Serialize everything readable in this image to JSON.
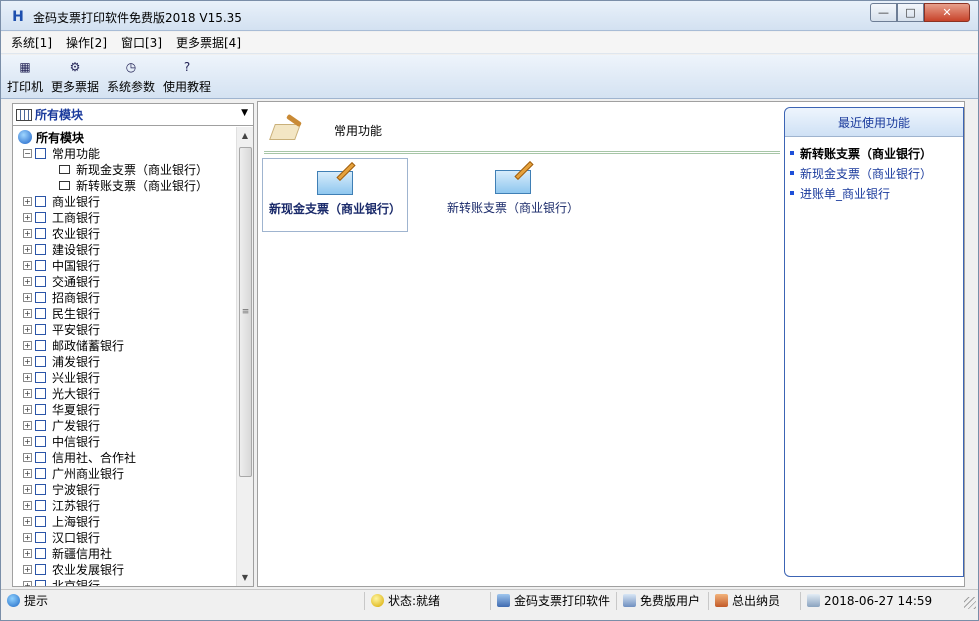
{
  "window": {
    "title": "金码支票打印软件免费版2018  V15.35",
    "min_label": "—",
    "max_label": "□",
    "close_label": "✕"
  },
  "menu": [
    "系统[1]",
    "操作[2]",
    "窗口[3]",
    "更多票据[4]"
  ],
  "toolbar": {
    "items": [
      {
        "label": "打印机",
        "icon": "printer-icon",
        "glyph": "▦"
      },
      {
        "label": "更多票据",
        "icon": "tickets-icon",
        "glyph": "⚙"
      },
      {
        "label": "系统参数",
        "icon": "settings-icon",
        "glyph": "◷"
      },
      {
        "label": "使用教程",
        "icon": "help-icon",
        "glyph": "?"
      }
    ]
  },
  "sidebar": {
    "header": "所有模块",
    "root": "所有模块",
    "common": {
      "label": "常用功能",
      "children": [
        "新现金支票（商业银行）",
        "新转账支票（商业银行）"
      ]
    },
    "banks": [
      "商业银行",
      "工商银行",
      "农业银行",
      "建设银行",
      "中国银行",
      "交通银行",
      "招商银行",
      "民生银行",
      "平安银行",
      "邮政储蓄银行",
      "浦发银行",
      "兴业银行",
      "光大银行",
      "华夏银行",
      "广发银行",
      "中信银行",
      "信用社、合作社",
      "广州商业银行",
      "宁波银行",
      "江苏银行",
      "上海银行",
      "汉口银行",
      "新疆信用社",
      "农业发展银行",
      "北京银行"
    ]
  },
  "main": {
    "section_title": "常用功能",
    "functions": [
      {
        "label": "新现金支票（商业银行）"
      },
      {
        "label": "新转账支票（商业银行）"
      }
    ]
  },
  "recent": {
    "title": "最近使用功能",
    "items": [
      "新转账支票（商业银行）",
      "新现金支票（商业银行）",
      "进账单_商业银行"
    ]
  },
  "status": {
    "hint": "提示",
    "state": "状态:就绪",
    "app": "金码支票打印软件",
    "user": "免费版用户",
    "role": "总出纳员",
    "datetime": "2018-06-27 14:59"
  }
}
